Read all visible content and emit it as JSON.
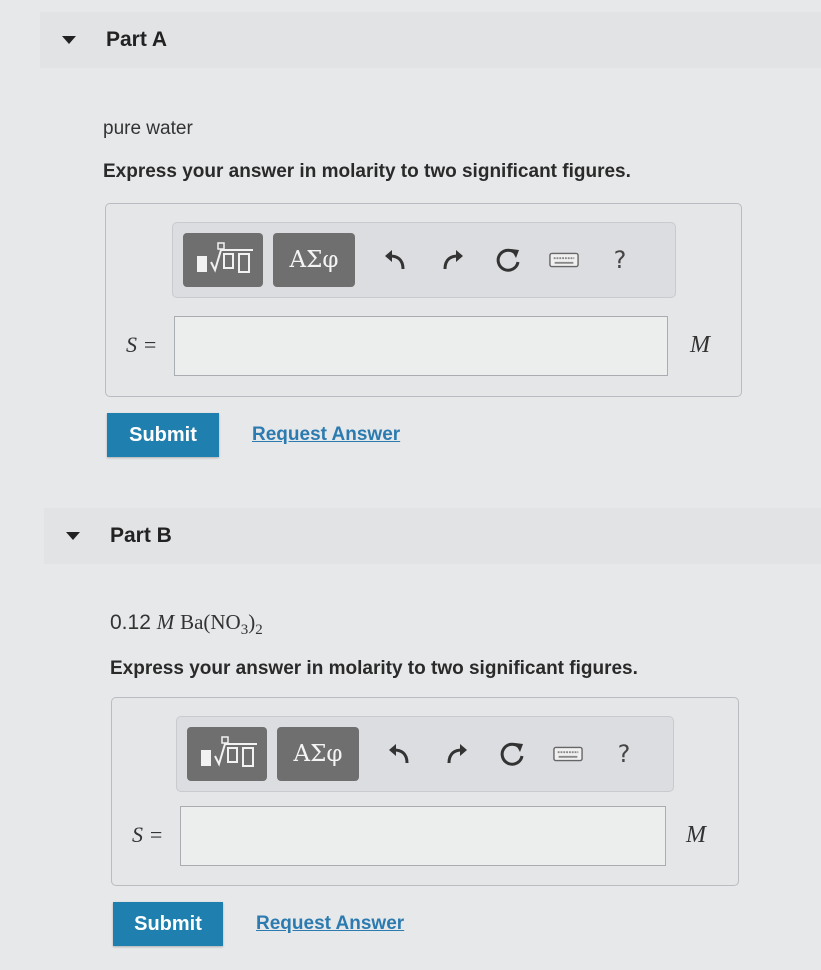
{
  "part_a": {
    "title": "Part A",
    "prompt": "pure water",
    "instruction": "Express your answer in molarity to two significant figures.",
    "greek_label": "ΑΣφ",
    "help_label": "?",
    "variable_label": "S =",
    "input_value": "",
    "unit": "M",
    "submit_label": "Submit",
    "request_label": "Request Answer"
  },
  "part_b": {
    "title": "Part B",
    "prompt_number": "0.12",
    "prompt_unit": "M",
    "prompt_formula_pre": "Ba(NO",
    "prompt_sub_1": "3",
    "prompt_formula_post": ")",
    "prompt_sub_2": "2",
    "instruction": "Express your answer in molarity to two significant figures.",
    "greek_label": "ΑΣφ",
    "help_label": "?",
    "variable_label": "S =",
    "input_value": "",
    "unit": "M",
    "submit_label": "Submit",
    "request_label": "Request Answer"
  },
  "colors": {
    "submit_bg": "#1f7fae",
    "link": "#2c7bb0",
    "toolbar_button": "#6f6f6f"
  }
}
